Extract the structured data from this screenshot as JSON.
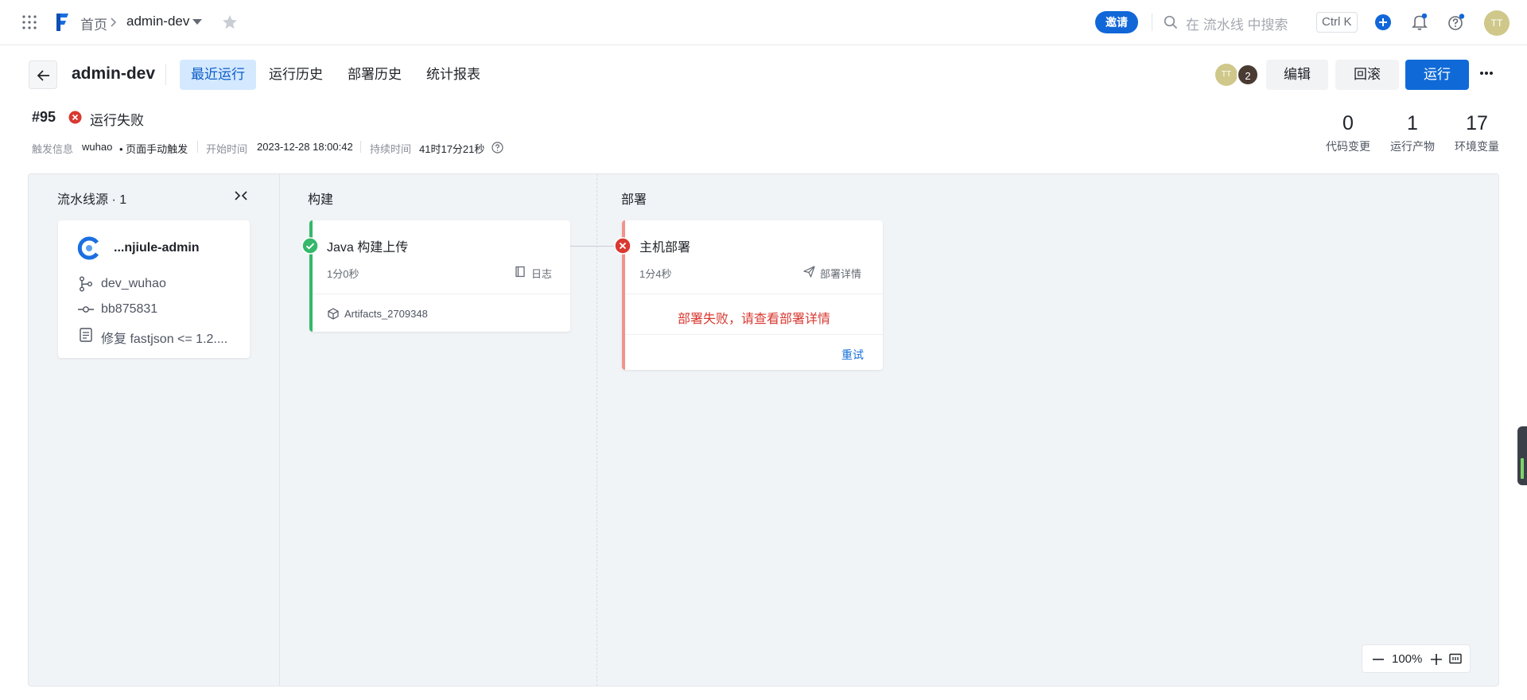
{
  "header": {
    "breadcrumb_home": "首页",
    "breadcrumb_current": "admin-dev",
    "invite_label": "邀请",
    "search_placeholder": "在 流水线 中搜索",
    "search_shortcut": "Ctrl K",
    "user_initials": "TT"
  },
  "subheader": {
    "title": "admin-dev",
    "tabs": [
      {
        "label": "最近运行",
        "active": true
      },
      {
        "label": "运行历史",
        "active": false
      },
      {
        "label": "部署历史",
        "active": false
      },
      {
        "label": "统计报表",
        "active": false
      }
    ],
    "member_initials": "TT",
    "member_count": "2",
    "edit_label": "编辑",
    "rollback_label": "回滚",
    "run_label": "运行"
  },
  "run": {
    "number": "#95",
    "status": "运行失败",
    "trigger_label": "触发信息",
    "trigger_user": "wuhao",
    "trigger_method": "• 页面手动触发",
    "start_label": "开始时间",
    "start_time": "2023-12-28 18:00:42",
    "duration_label": "持续时间",
    "duration": "41时17分21秒"
  },
  "stats": [
    {
      "value": "0",
      "label": "代码变更"
    },
    {
      "value": "1",
      "label": "运行产物"
    },
    {
      "value": "17",
      "label": "环境变量"
    }
  ],
  "pipeline": {
    "source_title": "流水线源 · 1",
    "source": {
      "repo": "...njiule-admin",
      "branch": "dev_wuhao",
      "commit": "bb875831",
      "message": "修复 fastjson <= 1.2...."
    },
    "build": {
      "stage_title": "构建",
      "job_name": "Java 构建上传",
      "duration": "1分0秒",
      "log_label": "日志",
      "artifact": "Artifacts_2709348",
      "status_color": "#34b86b"
    },
    "deploy": {
      "stage_title": "部署",
      "job_name": "主机部署",
      "duration": "1分4秒",
      "detail_label": "部署详情",
      "fail_message": "部署失败，请查看部署详情",
      "retry_label": "重试",
      "status_color": "#d83931"
    }
  },
  "zoom": {
    "level": "100%"
  },
  "colors": {
    "primary": "#0f6ad8",
    "success": "#34b86b",
    "danger": "#d83931"
  }
}
